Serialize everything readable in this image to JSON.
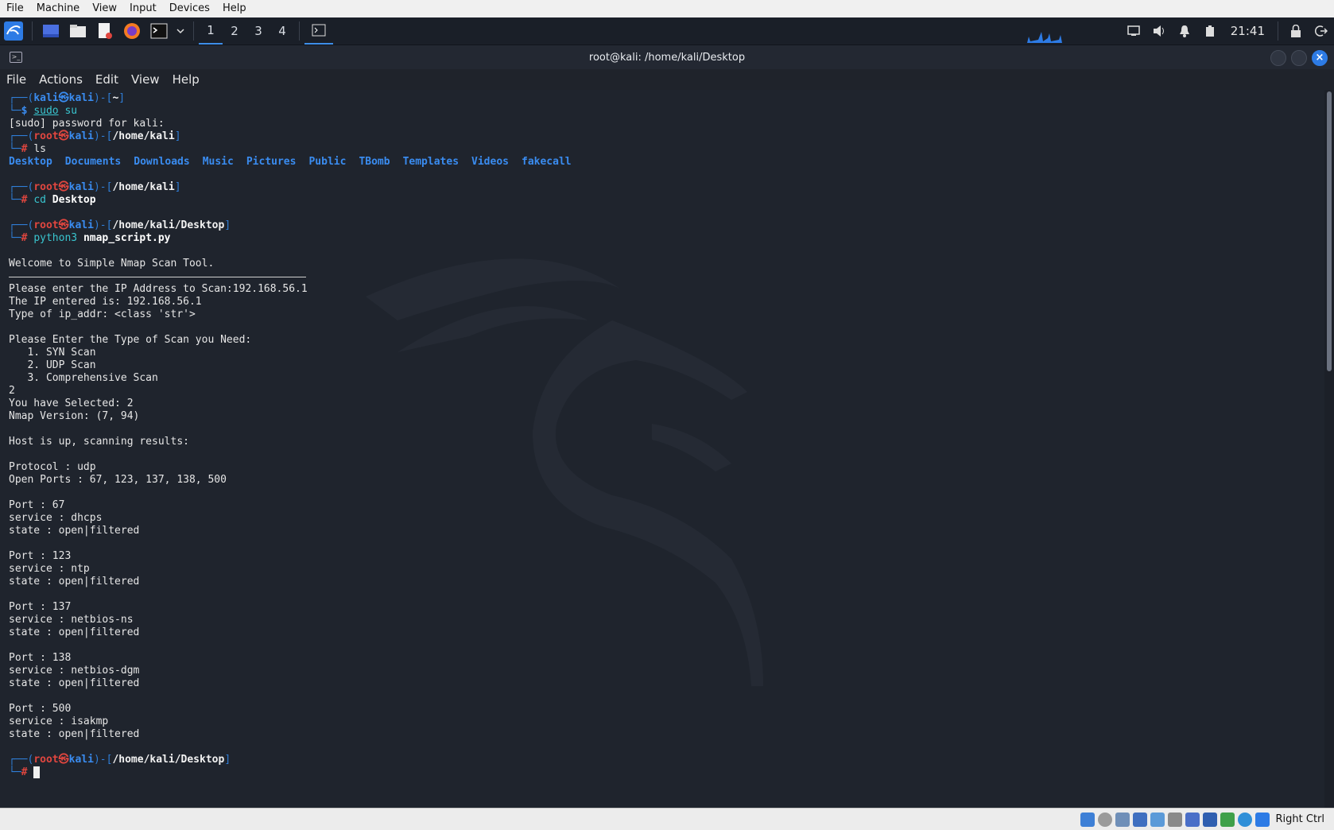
{
  "vbox_menu": [
    "File",
    "Machine",
    "View",
    "Input",
    "Devices",
    "Help"
  ],
  "panel": {
    "workspaces": [
      "1",
      "2",
      "3",
      "4"
    ],
    "clock": "21:41"
  },
  "window": {
    "title": "root@kali: /home/kali/Desktop",
    "menu": [
      "File",
      "Actions",
      "Edit",
      "View",
      "Help"
    ]
  },
  "terminal": {
    "user1": "kali",
    "host": "kali",
    "home": "~",
    "cmd_sudo": "sudo",
    "cmd_su": "su",
    "sudo_prompt": "[sudo] password for kali:",
    "root": "root",
    "path_home": "/home/kali",
    "cmd_ls": "ls",
    "ls_entries": [
      "Desktop",
      "Documents",
      "Downloads",
      "Music",
      "Pictures",
      "Public",
      "TBomb",
      "Templates",
      "Videos",
      "fakecall"
    ],
    "cmd_cd": "cd",
    "cmd_cd_arg": "Desktop",
    "path_desktop": "/home/kali/Desktop",
    "cmd_python": "python3",
    "cmd_python_arg": "nmap_script.py",
    "output_a": [
      "Welcome to Simple Nmap Scan Tool."
    ],
    "output_b": [
      "Please enter the IP Address to Scan:192.168.56.1",
      "The IP entered is: 192.168.56.1",
      "Type of ip_addr: <class 'str'>",
      "",
      "Please Enter the Type of Scan you Need:",
      "   1. SYN Scan",
      "   2. UDP Scan",
      "   3. Comprehensive Scan",
      "2",
      "You have Selected: 2",
      "Nmap Version: (7, 94)",
      "",
      "Host is up, scanning results:",
      "",
      "Protocol : udp",
      "Open Ports : 67, 123, 137, 138, 500",
      "",
      "Port : 67",
      "service : dhcps",
      "state : open|filtered",
      "",
      "Port : 123",
      "service : ntp",
      "state : open|filtered",
      "",
      "Port : 137",
      "service : netbios-ns",
      "state : open|filtered",
      "",
      "Port : 138",
      "service : netbios-dgm",
      "state : open|filtered",
      "",
      "Port : 500",
      "service : isakmp",
      "state : open|filtered",
      ""
    ]
  },
  "statusbar": {
    "host_key": "Right Ctrl"
  },
  "colors": {
    "accent": "#2f7ed8",
    "root_red": "#e0463f",
    "bg": "#1f242d"
  }
}
